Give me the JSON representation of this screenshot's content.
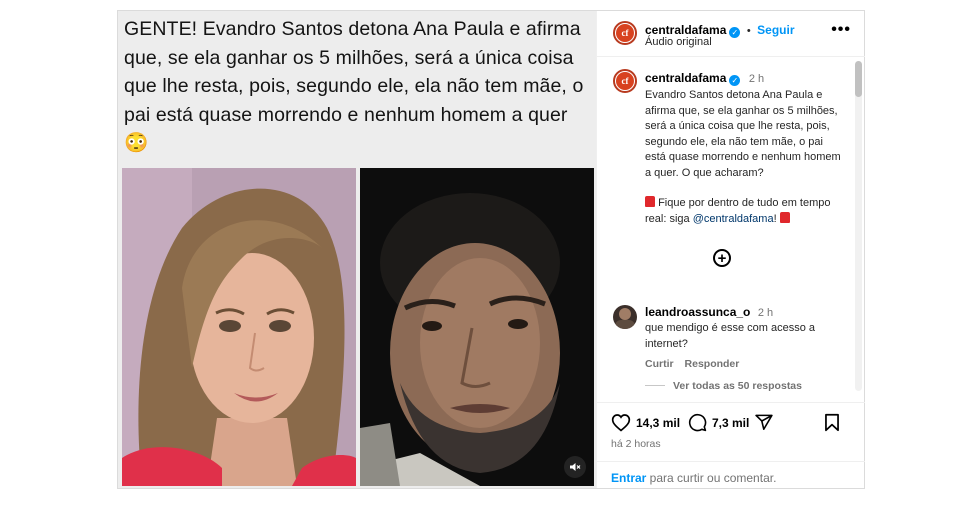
{
  "post": {
    "headline": "GENTE! Evandro Santos detona Ana Paula e afirma que, se ela ganhar os 5 milhões, será a única coisa que lhe resta, pois, segundo ele, ela não tem mãe, o pai está quase morrendo e nenhum homem a quer 😳",
    "header": {
      "username": "centraldafama",
      "follow_label": "Seguir",
      "separator": "•",
      "audio": "Áudio original",
      "more": "•••"
    },
    "caption": {
      "username": "centraldafama",
      "time": "2 h",
      "text": "Evandro Santos detona Ana Paula e afirma que, se ela ganhar os 5 milhões, será a única coisa que lhe resta, pois, segundo ele, ela não tem mãe, o pai está quase morrendo e nenhum homem a quer. O que acharam?",
      "cta_prefix": "Fique por dentro de tudo em tempo real: siga ",
      "cta_mention": "@centraldafama",
      "cta_suffix": "!"
    },
    "comment": {
      "username": "leandroassunca_o",
      "time": "2 h",
      "text": "que mendigo é esse com acesso a internet?",
      "like_label": "Curtir",
      "reply_label": "Responder",
      "view_replies": "Ver todas as 50 respostas"
    },
    "stats": {
      "likes": "14,3 mil",
      "comments": "7,3 mil",
      "posted": "há 2 horas"
    },
    "login_prompt": {
      "link": "Entrar",
      "text": " para curtir ou comentar."
    },
    "icons": {
      "verified": "verified-badge-icon",
      "add": "add-circle-icon",
      "like": "heart-icon",
      "comment": "comment-icon",
      "share": "send-icon",
      "save": "bookmark-icon",
      "mute": "muted-speaker-icon"
    },
    "colors": {
      "link": "#0095f6",
      "mention": "#00376b",
      "muted_text": "#737373"
    }
  }
}
